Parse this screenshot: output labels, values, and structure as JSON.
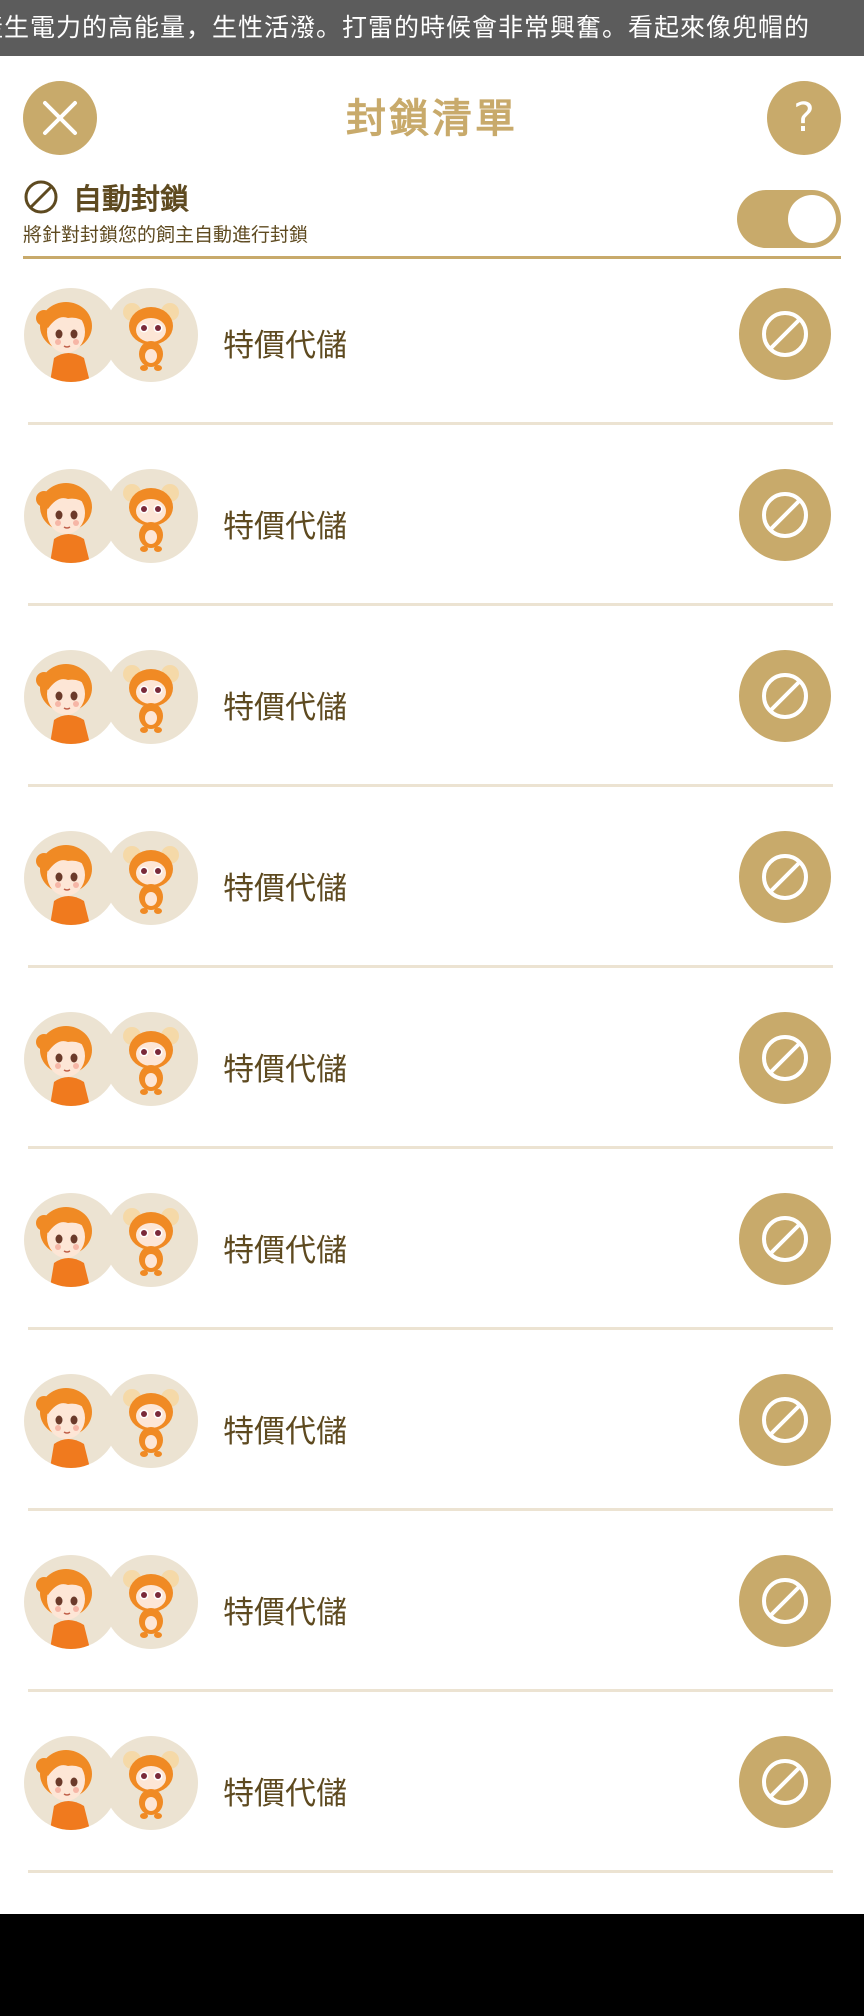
{
  "marquee": {
    "text": "產生電力的高能量，生性活潑。打雷的時候會非常興奮。看起來像兜帽的"
  },
  "header": {
    "title": "封鎖清單",
    "help_glyph": "?"
  },
  "auto_block": {
    "label": "自動封鎖",
    "description": "將針對封鎖您的飼主自動進行封鎖",
    "enabled": true
  },
  "colors": {
    "accent": "#c8aa6b",
    "text": "#5e4a20",
    "avatar_bg": "#ece3d2"
  },
  "blocked_list": [
    {
      "name": "特價代儲"
    },
    {
      "name": "特價代儲"
    },
    {
      "name": "特價代儲"
    },
    {
      "name": "特價代儲"
    },
    {
      "name": "特價代儲"
    },
    {
      "name": "特價代儲"
    },
    {
      "name": "特價代儲"
    },
    {
      "name": "特價代儲"
    },
    {
      "name": "特價代儲"
    }
  ]
}
